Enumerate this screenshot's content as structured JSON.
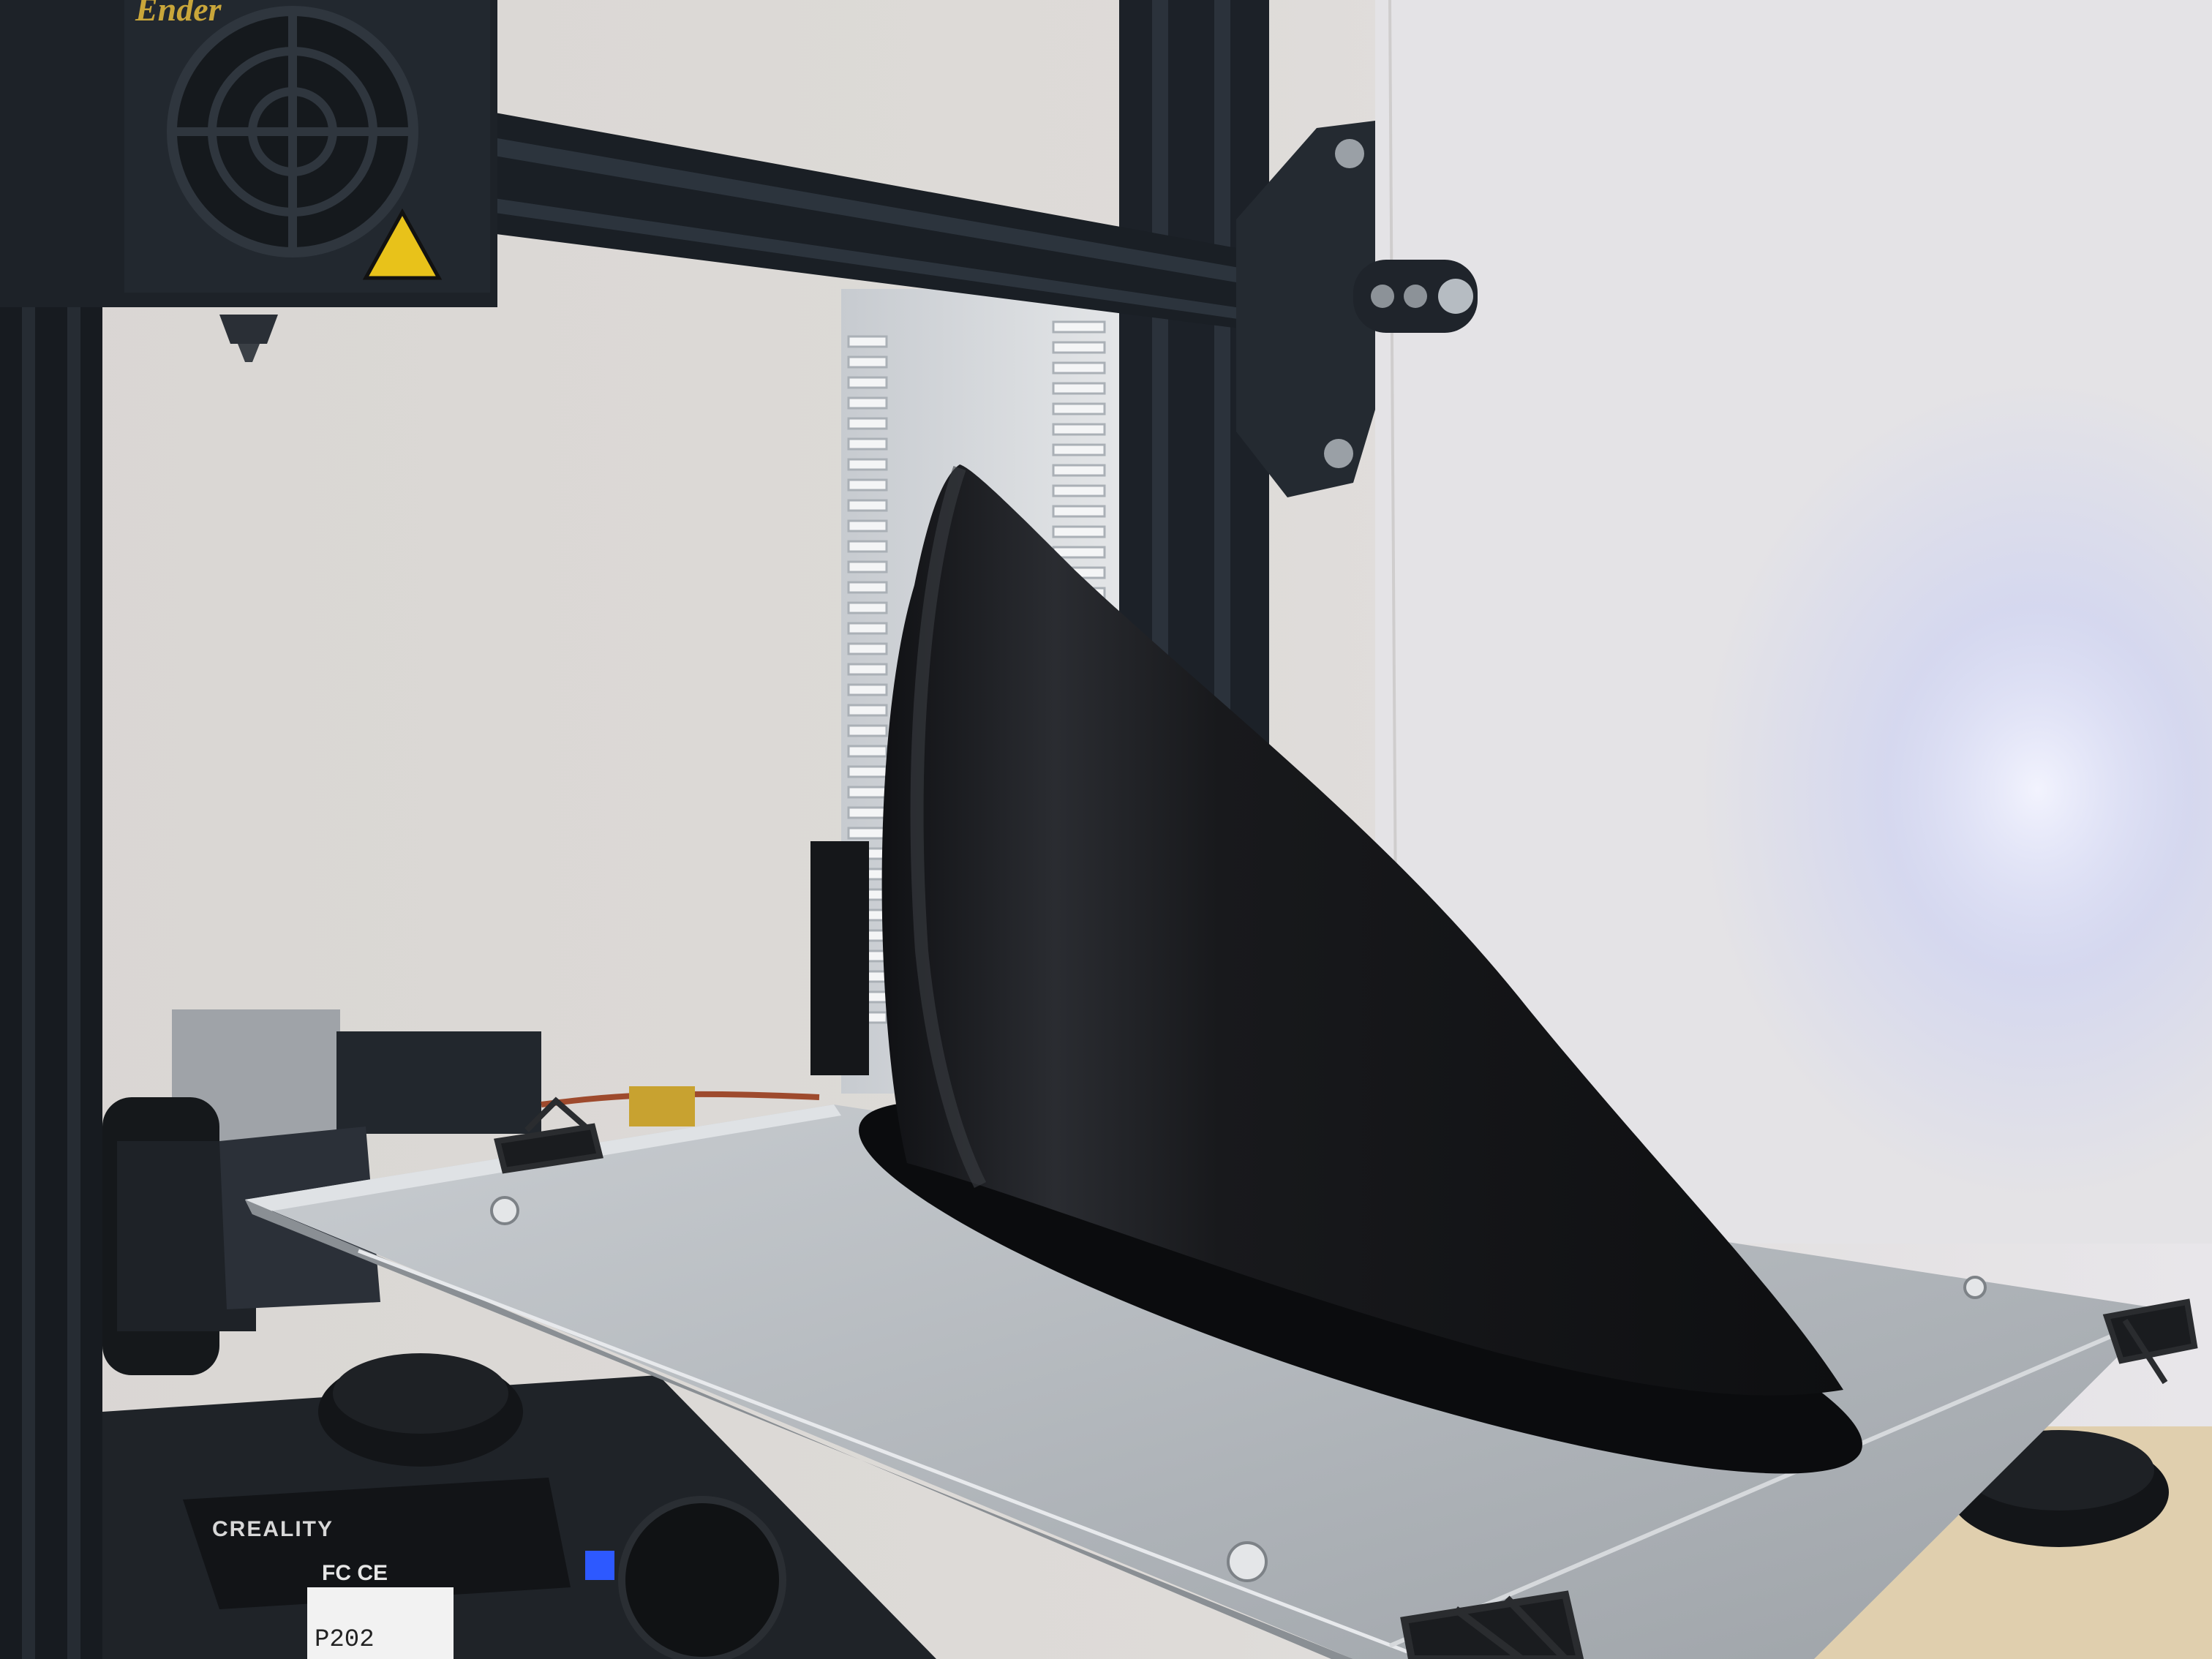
{
  "scene": {
    "description_colors": {
      "wall": "#dcd9d6",
      "wall_lit": "#eef0fb",
      "frame": "#1b2026",
      "bed": "#b9bec3",
      "print": "#16171a",
      "blue_light": "#cdd3ff"
    }
  },
  "printhead": {
    "brand_label": "Ender"
  },
  "psu": {
    "brand_label": "CREALITY",
    "cert_marks": "FC CE",
    "serial_fragment": "P202"
  }
}
